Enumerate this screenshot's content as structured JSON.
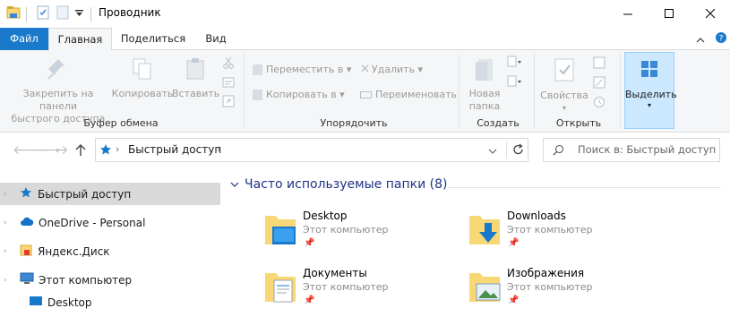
{
  "window": {
    "title": "Проводник",
    "minimize": "minimize",
    "maximize": "maximize",
    "close": "close"
  },
  "tabs": {
    "file": "Файл",
    "home": "Главная",
    "share": "Поделиться",
    "view": "Вид"
  },
  "ribbon": {
    "clipboard": {
      "pin_line1": "Закрепить на панели",
      "pin_line2": "быстрого доступа",
      "copy": "Копировать",
      "paste": "Вставить",
      "label": "Буфер обмена"
    },
    "organize": {
      "move_to": "Переместить в",
      "copy_to": "Копировать в",
      "delete": "Удалить",
      "rename": "Переименовать",
      "label": "Упорядочить"
    },
    "new": {
      "new_folder_line1": "Новая",
      "new_folder_line2": "папка",
      "label": "Создать"
    },
    "open": {
      "properties": "Свойства",
      "label": "Открыть"
    },
    "select": {
      "label": "Выделить"
    }
  },
  "address": {
    "path": "Быстрый доступ",
    "search_placeholder": "Поиск в: Быстрый доступ"
  },
  "nav": {
    "items": [
      {
        "label": "Быстрый доступ"
      },
      {
        "label": "OneDrive - Personal"
      },
      {
        "label": "Яндекс.Диск"
      },
      {
        "label": "Этот компьютер"
      },
      {
        "label": "Desktop"
      }
    ]
  },
  "content": {
    "group_title": "Часто используемые папки (8)",
    "folders": [
      {
        "name": "Desktop",
        "location": "Этот компьютер"
      },
      {
        "name": "Downloads",
        "location": "Этот компьютер"
      },
      {
        "name": "Документы",
        "location": "Этот компьютер"
      },
      {
        "name": "Изображения",
        "location": "Этот компьютер"
      }
    ]
  },
  "colors": {
    "accent": "#1979ca",
    "selection": "#cce8ff",
    "folder": "#f8d775",
    "group_title": "#1e3287"
  }
}
